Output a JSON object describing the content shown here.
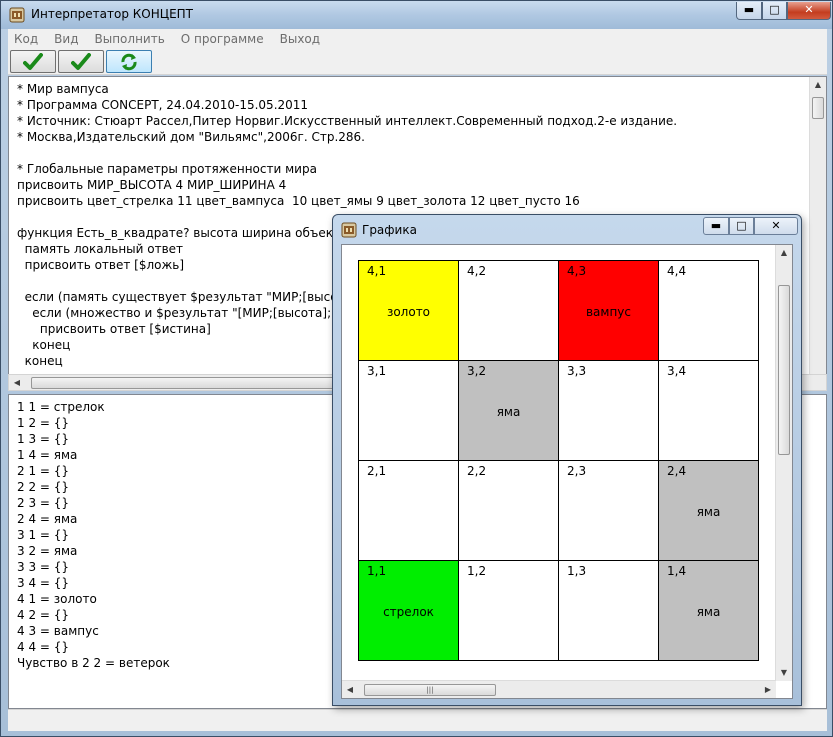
{
  "window": {
    "title": "Интерпретатор КОНЦЕПТ"
  },
  "menu": [
    "Код",
    "Вид",
    "Выполнить",
    "О программе",
    "Выход"
  ],
  "editor_lines": [
    "* Мир вампуса",
    "* Программа CONCEPT, 24.04.2010-15.05.2011",
    "* Источник: Стюарт Рассел,Питер Норвиг.Искусственный интеллект.Современный подход.2-е издание.",
    "* Москва,Издательский дом \"Вильямс\",2006г. Стр.286.",
    "",
    "* Глобальные параметры протяженности мира",
    "присвоить МИР_ВЫСОТА 4 МИР_ШИРИНА 4",
    "присвоить цвет_стрелка 11 цвет_вампуса  10 цвет_ямы 9 цвет_золота 12 цвет_пусто 16",
    "",
    "функция Есть_в_квадрате? высота ширина объект",
    "  память локальный ответ",
    "  присвоить ответ [$ложь]",
    "",
    "  если (память существует $результат \"МИР;[высота]",
    "    если (множество и $результат \"[МИР;[высота];[ши",
    "      присвоить ответ [$истина]",
    "    конец",
    "  конец"
  ],
  "output_lines": [
    "1 1 = стрелок",
    "1 2 = {}",
    "1 3 = {}",
    "1 4 = яма",
    "2 1 = {}",
    "2 2 = {}",
    "2 3 = {}",
    "2 4 = яма",
    "3 1 = {}",
    "3 2 = яма",
    "3 3 = {}",
    "3 4 = {}",
    "4 1 = золото",
    "4 2 = {}",
    "4 3 = вампус",
    "4 4 = {}",
    "Чувство в 2 2 = ветерок"
  ],
  "graphics": {
    "title": "Графика",
    "rows": [
      [
        {
          "coord": "4,1",
          "label": "золото",
          "color": "#ffff00"
        },
        {
          "coord": "4,2",
          "label": "",
          "color": "#ffffff"
        },
        {
          "coord": "4,3",
          "label": "вампус",
          "color": "#ff0000"
        },
        {
          "coord": "4,4",
          "label": "",
          "color": "#ffffff"
        }
      ],
      [
        {
          "coord": "3,1",
          "label": "",
          "color": "#ffffff"
        },
        {
          "coord": "3,2",
          "label": "яма",
          "color": "#c0c0c0"
        },
        {
          "coord": "3,3",
          "label": "",
          "color": "#ffffff"
        },
        {
          "coord": "3,4",
          "label": "",
          "color": "#ffffff"
        }
      ],
      [
        {
          "coord": "2,1",
          "label": "",
          "color": "#ffffff"
        },
        {
          "coord": "2,2",
          "label": "",
          "color": "#ffffff"
        },
        {
          "coord": "2,3",
          "label": "",
          "color": "#ffffff"
        },
        {
          "coord": "2,4",
          "label": "яма",
          "color": "#c0c0c0"
        }
      ],
      [
        {
          "coord": "1,1",
          "label": "стрелок",
          "color": "#00ee00"
        },
        {
          "coord": "1,2",
          "label": "",
          "color": "#ffffff"
        },
        {
          "coord": "1,3",
          "label": "",
          "color": "#ffffff"
        },
        {
          "coord": "1,4",
          "label": "яма",
          "color": "#c0c0c0"
        }
      ]
    ]
  },
  "toolbar": {
    "icons": [
      "check-icon",
      "check-icon",
      "refresh-icon"
    ]
  },
  "colors": {
    "check": "#1a8a1a",
    "refresh": "#1a8a1a"
  }
}
